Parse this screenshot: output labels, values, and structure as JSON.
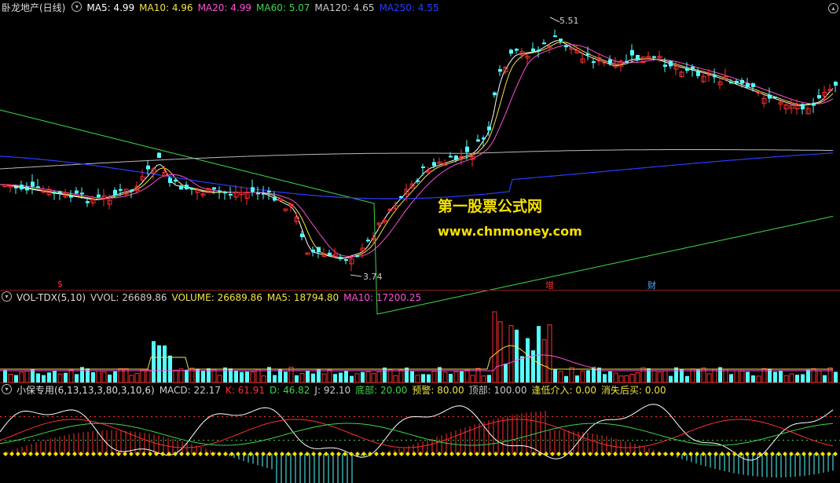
{
  "main": {
    "title": "卧龙地产(日线)",
    "ma": [
      {
        "label": "MA5: 4.99",
        "color": "#ffffff"
      },
      {
        "label": "MA10: 4.96",
        "color": "#f0e442"
      },
      {
        "label": "MA20: 4.99",
        "color": "#ff4fd8"
      },
      {
        "label": "MA60: 5.07",
        "color": "#3fd54b"
      },
      {
        "label": "MA120: 4.65",
        "color": "#cccccc"
      },
      {
        "label": "MA250: 4.55",
        "color": "#2a3cff"
      }
    ],
    "high_label": "5.51",
    "low_label": "3.74",
    "markers": [
      {
        "text": "$",
        "color": "#ff3030"
      },
      {
        "text": "增",
        "color": "#ff3030"
      },
      {
        "text": "财",
        "color": "#4aa8ff"
      }
    ],
    "watermark_cn": "第一股票公式网",
    "watermark_url": "www.chnmoney.com"
  },
  "volume": {
    "title": "VOL-TDX(5,10)",
    "items": [
      {
        "label": "VVOL: 26689.86",
        "color": "#cccccc"
      },
      {
        "label": "VOLUME: 26689.86",
        "color": "#f0e442"
      },
      {
        "label": "MA5: 18794.80",
        "color": "#f0e442"
      },
      {
        "label": "MA10: 17200.25",
        "color": "#ff4fd8"
      }
    ]
  },
  "indicator": {
    "title": "小保专用(6,13,13,3,80,3,10,6)",
    "items": [
      {
        "label": "MACD: 22.17",
        "color": "#cccccc"
      },
      {
        "label": "K: 61.91",
        "color": "#ff3030"
      },
      {
        "label": "D: 46.82",
        "color": "#3fd54b"
      },
      {
        "label": "J: 92.10",
        "color": "#cccccc"
      },
      {
        "label": "底部: 20.00",
        "color": "#3fd54b"
      },
      {
        "label": "预警: 80.00",
        "color": "#f0e442"
      },
      {
        "label": "顶部: 100.00",
        "color": "#cccccc"
      },
      {
        "label": "逢低介入: 0.00",
        "color": "#f0e442"
      },
      {
        "label": "消失后买: 0.00",
        "color": "#f0e442"
      }
    ]
  },
  "colors": {
    "up": "#ff3030",
    "down": "#54ffff",
    "grid": "#8b1b1b"
  }
}
